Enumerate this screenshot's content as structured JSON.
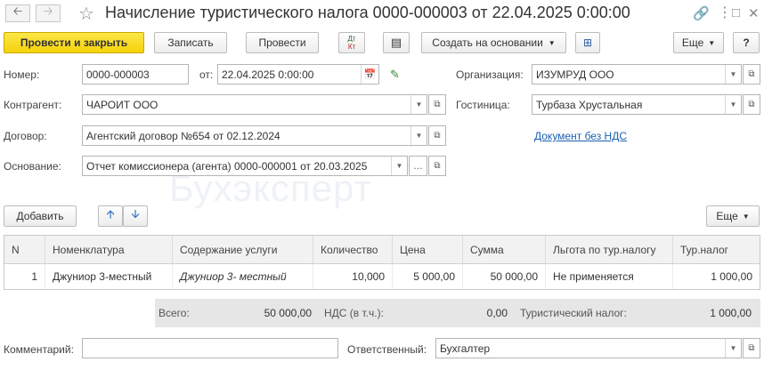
{
  "window": {
    "title": "Начисление туристического налога 0000-000003 от 22.04.2025 0:00:00"
  },
  "toolbar": {
    "post_and_close": "Провести и закрыть",
    "save": "Записать",
    "post": "Провести",
    "dt_kt_top": "Дт",
    "dt_kt_bottom": "Кт",
    "create_based_on": "Создать на основании",
    "more": "Еще",
    "help": "?"
  },
  "form": {
    "number_label": "Номер:",
    "number_value": "0000-000003",
    "date_label": "от:",
    "date_value": "22.04.2025  0:00:00",
    "organization_label": "Организация:",
    "organization_value": "ИЗУМРУД ООО",
    "counterparty_label": "Контрагент:",
    "counterparty_value": "ЧАРОИТ ООО",
    "hotel_label": "Гостиница:",
    "hotel_value": "Турбаза Хрустальная",
    "contract_label": "Договор:",
    "contract_value": "Агентский договор №654 от 02.12.2024",
    "vat_link": "Документ без НДС",
    "basis_label": "Основание:",
    "basis_value": "Отчет комиссионера (агента) 0000-000001 от 20.03.2025",
    "comment_label": "Комментарий:",
    "comment_value": "",
    "responsible_label": "Ответственный:",
    "responsible_value": "Бухгалтер"
  },
  "table_toolbar": {
    "add": "Добавить",
    "more": "Еще"
  },
  "table": {
    "columns": [
      "N",
      "Номенклатура",
      "Содержание услуги",
      "Количество",
      "Цена",
      "Сумма",
      "Льгота по тур.налогу",
      "Тур.налог"
    ],
    "rows": [
      [
        "1",
        "Джуниор 3-местный",
        "Джуниор 3- местный",
        "10,000",
        "5 000,00",
        "50 000,00",
        "Не применяется",
        "1 000,00"
      ]
    ]
  },
  "totals": {
    "total_label": "Всего:",
    "total_value": "50 000,00",
    "vat_label": "НДС (в т.ч.):",
    "vat_value": "0,00",
    "tourist_tax_label": "Туристический налог:",
    "tourist_tax_value": "1 000,00"
  },
  "watermark": "Бухэксперт",
  "colors": {
    "primary_button": "#f5d20a",
    "link": "#1a5fb4",
    "totals_bg": "#e6e6e6"
  }
}
